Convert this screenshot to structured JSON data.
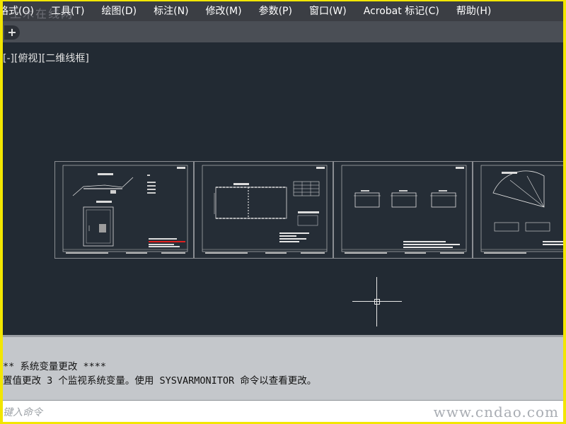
{
  "menubar": {
    "items": [
      "格式(O)",
      "工具(T)",
      "绘图(D)",
      "标注(N)",
      "修改(M)",
      "参数(P)",
      "窗口(W)",
      "Acrobat 标记(C)",
      "帮助(H)"
    ]
  },
  "watermark_top": "土木在线网",
  "tabs": {
    "new_tab_symbol": "+"
  },
  "viewport": {
    "label": "[-][俯视][二维线框]"
  },
  "command_history": {
    "line1": "** 系统变量更改 ****",
    "line2": "置值更改 3 个监视系统变量。使用 SYSVARMONITOR 命令以查看更改。"
  },
  "command_line": {
    "placeholder": "键入命令"
  },
  "watermark_bottom": "www.cndao.com",
  "colors": {
    "frame_border": "#f2e600",
    "canvas": "#222a33",
    "menubar": "#3b3e44",
    "history_bg": "#c4c7cb",
    "accent_red": "#e02020"
  }
}
